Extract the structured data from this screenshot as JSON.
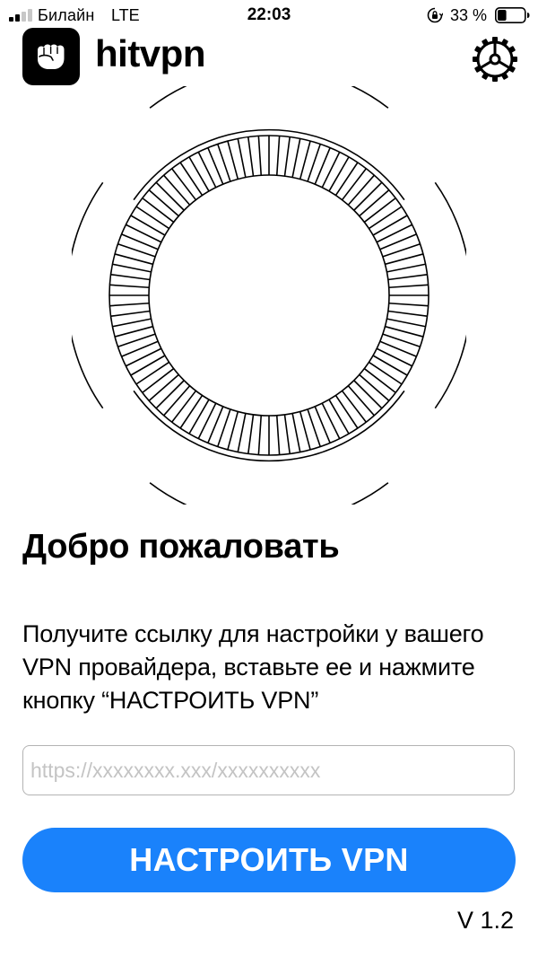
{
  "status_bar": {
    "carrier": "Билайн",
    "network": "LTE",
    "time": "22:03",
    "battery_percent": "33 %",
    "battery_level": 0.33,
    "signal_bars_active": 2,
    "signal_bars_total": 4
  },
  "header": {
    "app_name": "hitvpn",
    "logo_icon": "fist-icon",
    "settings_icon": "gear-icon"
  },
  "welcome": {
    "title": "Добро пожаловать",
    "instructions": "Получите ссылку для настройки у вашего VPN провайдера, вставьте ее и нажмите кнопку “НАСТРОИТЬ VPN”"
  },
  "url_input": {
    "value": "",
    "placeholder": "https://xxxxxxxx.xxx/xxxxxxxxxx"
  },
  "setup_button": {
    "label": "НАСТРОИТЬ VPN"
  },
  "footer": {
    "version": "V 1.2"
  },
  "colors": {
    "accent": "#1a82fb",
    "background": "#ffffff",
    "text": "#000000",
    "input_border": "#b3b3b3",
    "placeholder": "#c4c4c4"
  }
}
